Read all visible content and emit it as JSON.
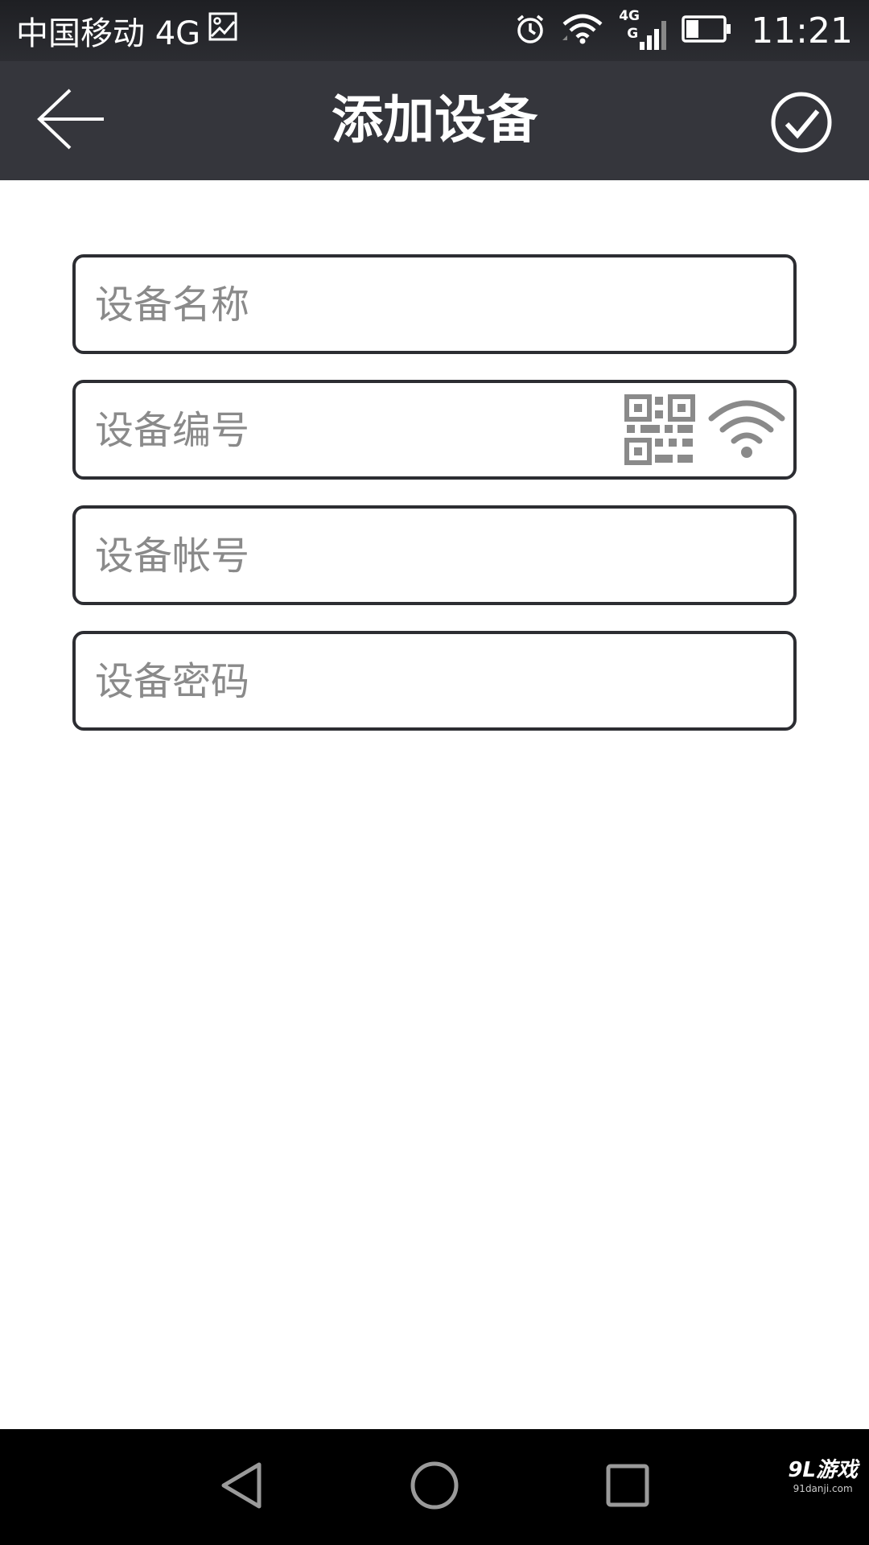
{
  "status_bar": {
    "carrier": "中国移动 4G",
    "network_small": "4G",
    "network_letter": "G",
    "time": "11:21",
    "battery_level": 0.35
  },
  "header": {
    "title": "添加设备",
    "back_icon": "arrow-left-icon",
    "confirm_icon": "check-circle-icon"
  },
  "form": {
    "fields": [
      {
        "placeholder": "设备名称",
        "value": ""
      },
      {
        "placeholder": "设备编号",
        "value": "",
        "icons": [
          "qr-code-icon",
          "wifi-icon"
        ]
      },
      {
        "placeholder": "设备帐号",
        "value": ""
      },
      {
        "placeholder": "设备密码",
        "value": ""
      }
    ]
  },
  "nav_bar": {
    "icons": [
      "triangle-back-icon",
      "circle-home-icon",
      "square-recent-icon"
    ]
  },
  "watermark": {
    "main": "9L游戏",
    "sub": "91danji.com"
  },
  "colors": {
    "status_bar_bg": "#2c2d32",
    "title_bar_bg": "#35363c",
    "field_border": "#2c2d32",
    "placeholder": "#8a8a8a",
    "icon_gray": "#8a8a8a",
    "nav_bar_bg": "#000000"
  }
}
